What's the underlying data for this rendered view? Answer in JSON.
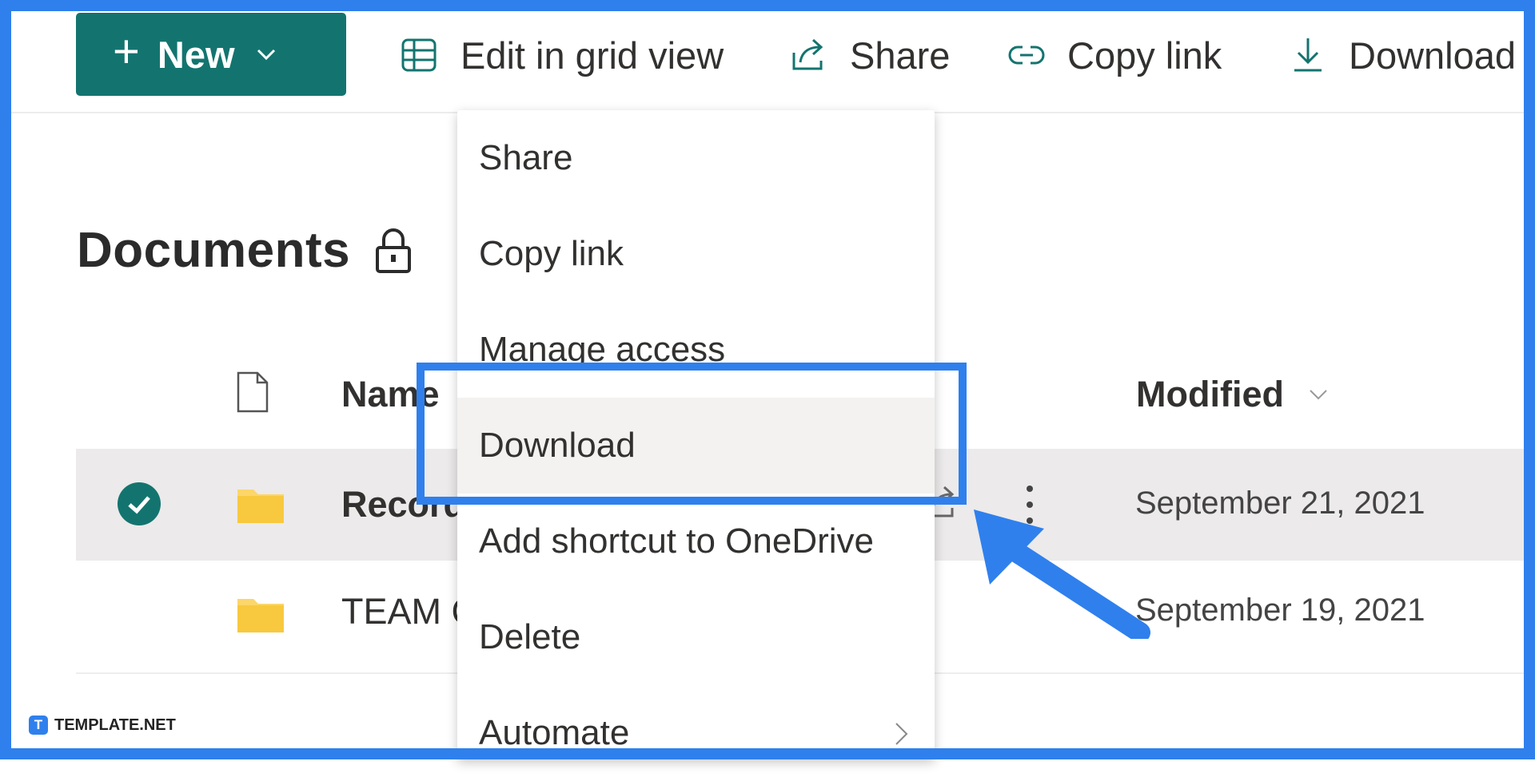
{
  "toolbar": {
    "new_label": "New",
    "edit_grid_label": "Edit in grid view",
    "share_label": "Share",
    "copy_link_label": "Copy link",
    "download_label": "Download"
  },
  "page_title": "Documents",
  "list": {
    "name_header": "Name",
    "modified_header": "Modified",
    "rows": [
      {
        "name": "Record",
        "modified": "September 21, 2021",
        "selected": true
      },
      {
        "name": "TEAM C",
        "modified": "September 19, 2021",
        "selected": false
      }
    ]
  },
  "context_menu": {
    "items": [
      {
        "label": "Share"
      },
      {
        "label": "Copy link"
      },
      {
        "label": "Manage access"
      },
      {
        "label": "Download"
      },
      {
        "label": "Add shortcut to OneDrive"
      },
      {
        "label": "Delete"
      },
      {
        "label": "Automate"
      }
    ]
  },
  "watermark": "TEMPLATE.NET",
  "colors": {
    "accent": "#13746f",
    "annotation": "#2f80ed",
    "folder": "#fcd669"
  }
}
